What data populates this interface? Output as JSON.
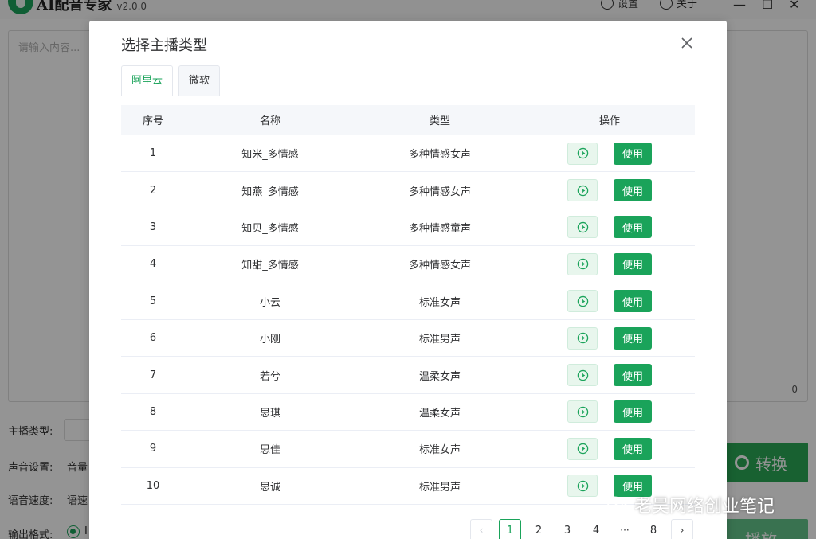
{
  "app": {
    "title": "AI配音专家",
    "version": "v2.0.0",
    "settings_label": "设置",
    "about_label": "关于",
    "editor_placeholder": "请输入内容...",
    "char_count": "0",
    "form": {
      "anchor_type_label": "主播类型:",
      "voice_settings_label": "声音设置:",
      "volume_label": "音量",
      "speech_speed_label": "语音速度:",
      "speed_label": "语速",
      "output_format_label": "输出格式:",
      "output_format_value": "I"
    },
    "convert_label": "转换",
    "play_label": "播放"
  },
  "dialog": {
    "title": "选择主播类型",
    "tabs": [
      {
        "label": "阿里云",
        "active": true
      },
      {
        "label": "微软",
        "active": false
      }
    ],
    "columns": [
      "序号",
      "名称",
      "类型",
      "操作"
    ],
    "use_label": "使用",
    "rows": [
      {
        "index": "1",
        "name": "知米_多情感",
        "type": "多种情感女声"
      },
      {
        "index": "2",
        "name": "知燕_多情感",
        "type": "多种情感女声"
      },
      {
        "index": "3",
        "name": "知贝_多情感",
        "type": "多种情感童声"
      },
      {
        "index": "4",
        "name": "知甜_多情感",
        "type": "多种情感女声"
      },
      {
        "index": "5",
        "name": "小云",
        "type": "标准女声"
      },
      {
        "index": "6",
        "name": "小刚",
        "type": "标准男声"
      },
      {
        "index": "7",
        "name": "若兮",
        "type": "温柔女声"
      },
      {
        "index": "8",
        "name": "思琪",
        "type": "温柔女声"
      },
      {
        "index": "9",
        "name": "思佳",
        "type": "标准女声"
      },
      {
        "index": "10",
        "name": "思诚",
        "type": "标准男声"
      }
    ],
    "pagination": {
      "pages": [
        "1",
        "2",
        "3",
        "4"
      ],
      "ellipsis": "···",
      "last_page": "8",
      "current": "1"
    }
  },
  "watermark": "老吴网络创业笔记",
  "colors": {
    "accent": "#1aa35a",
    "accent_light": "#e8f6ed",
    "header_bg": "#f5f7fa"
  }
}
